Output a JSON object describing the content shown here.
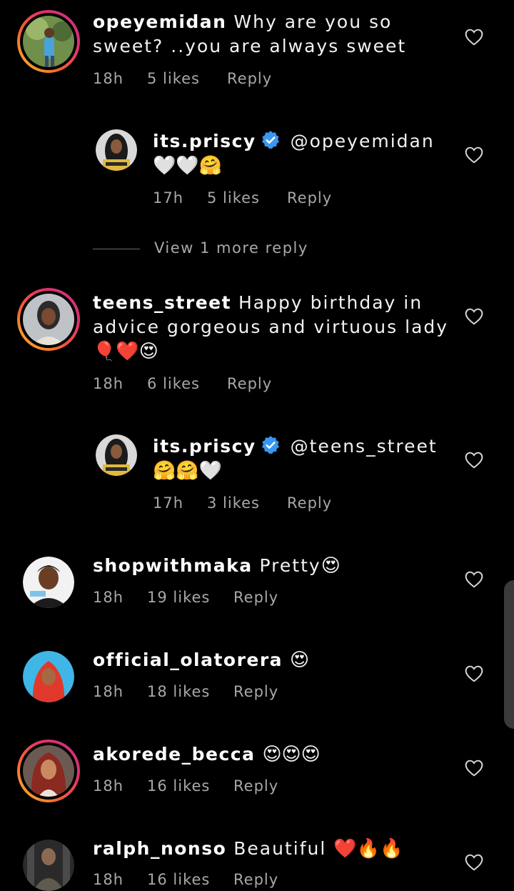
{
  "comments": [
    {
      "username": "opeyemidan",
      "text": " Why are you so sweet? ..you are always sweet",
      "emoji": "",
      "time": "18h",
      "likes": "5 likes",
      "reply_label": "Reply"
    },
    {
      "username": "its.priscy",
      "verified": true,
      "text": " @opeyemidan ",
      "emoji": "🤍🤍🤗",
      "time": "17h",
      "likes": "5 likes",
      "reply_label": "Reply"
    },
    {
      "username": "teens_street",
      "text": " Happy birthday in advice gorgeous and virtuous lady",
      "emoji": "🎈❤️😍",
      "time": "18h",
      "likes": "6 likes",
      "reply_label": "Reply"
    },
    {
      "username": "its.priscy",
      "verified": true,
      "text": " @teens_street ",
      "emoji": "🤗🤗🤍",
      "time": "17h",
      "likes": "3 likes",
      "reply_label": "Reply"
    },
    {
      "username": "shopwithmaka",
      "text": " Pretty",
      "emoji": "😍",
      "time": "18h",
      "likes": "19 likes",
      "reply_label": "Reply"
    },
    {
      "username": "official_olatorera",
      "text": " ",
      "emoji": "😍",
      "time": "18h",
      "likes": "18 likes",
      "reply_label": "Reply"
    },
    {
      "username": "akorede_becca",
      "text": " ",
      "emoji": "😍😍😍",
      "time": "18h",
      "likes": "16 likes",
      "reply_label": "Reply"
    },
    {
      "username": "ralph_nonso",
      "text": " Beautiful ",
      "emoji": "❤️🔥🔥",
      "time": "18h",
      "likes": "16 likes",
      "reply_label": "Reply"
    }
  ],
  "view_more_replies": "View 1 more reply",
  "colors": {
    "background": "#000000",
    "text": "#f2f2f2",
    "meta": "#a8a8a8",
    "verified": "#3897f0",
    "story_ring": "#e1306c"
  },
  "icons": [
    "heart-outline-icon",
    "verified-badge-icon"
  ]
}
